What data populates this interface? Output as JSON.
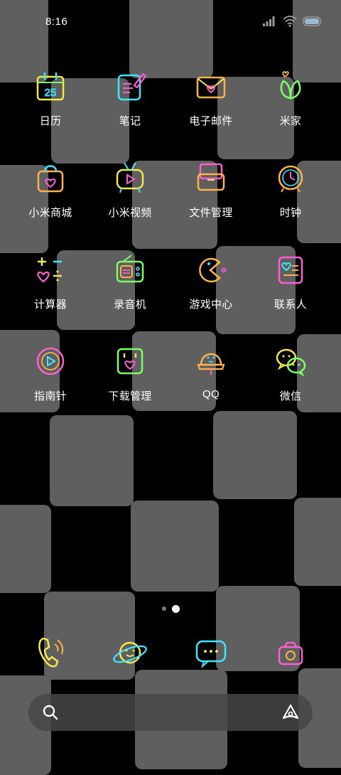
{
  "status_bar": {
    "time": "8:16",
    "signal_icon": "signal-bars-icon",
    "wifi_icon": "wifi-icon",
    "battery_icon": "battery-icon"
  },
  "home_apps": [
    {
      "label": "日历",
      "icon": "calendar-icon"
    },
    {
      "label": "笔记",
      "icon": "notes-icon"
    },
    {
      "label": "电子邮件",
      "icon": "email-icon"
    },
    {
      "label": "米家",
      "icon": "mijia-icon"
    },
    {
      "label": "小米商城",
      "icon": "shopping-bag-icon"
    },
    {
      "label": "小米视频",
      "icon": "tv-icon"
    },
    {
      "label": "文件管理",
      "icon": "folder-icon"
    },
    {
      "label": "时钟",
      "icon": "clock-icon"
    },
    {
      "label": "计算器",
      "icon": "calculator-icon"
    },
    {
      "label": "录音机",
      "icon": "radio-recorder-icon"
    },
    {
      "label": "游戏中心",
      "icon": "pacman-icon"
    },
    {
      "label": "联系人",
      "icon": "contacts-icon"
    },
    {
      "label": "指南针",
      "icon": "compass-icon"
    },
    {
      "label": "下载管理",
      "icon": "download-icon"
    },
    {
      "label": "QQ",
      "icon": "qq-penguin-icon"
    },
    {
      "label": "微信",
      "icon": "wechat-icon"
    }
  ],
  "calendar_date": "25",
  "pager": {
    "pages": 2,
    "current": 2
  },
  "dock": [
    {
      "icon": "phone-icon"
    },
    {
      "icon": "planet-smile-icon"
    },
    {
      "icon": "message-bubble-icon"
    },
    {
      "icon": "camera-icon"
    }
  ],
  "search_bar": {
    "search_icon": "search-icon",
    "assistant_icon": "assistant-icon"
  },
  "colors": {
    "background": "#000000",
    "tile": "#5f5f5f",
    "neon_yellow": "#f5e84a",
    "neon_cyan": "#3fe6ff",
    "neon_pink": "#ff5fd2",
    "neon_orange": "#ffb347",
    "neon_green": "#7dff6a"
  }
}
